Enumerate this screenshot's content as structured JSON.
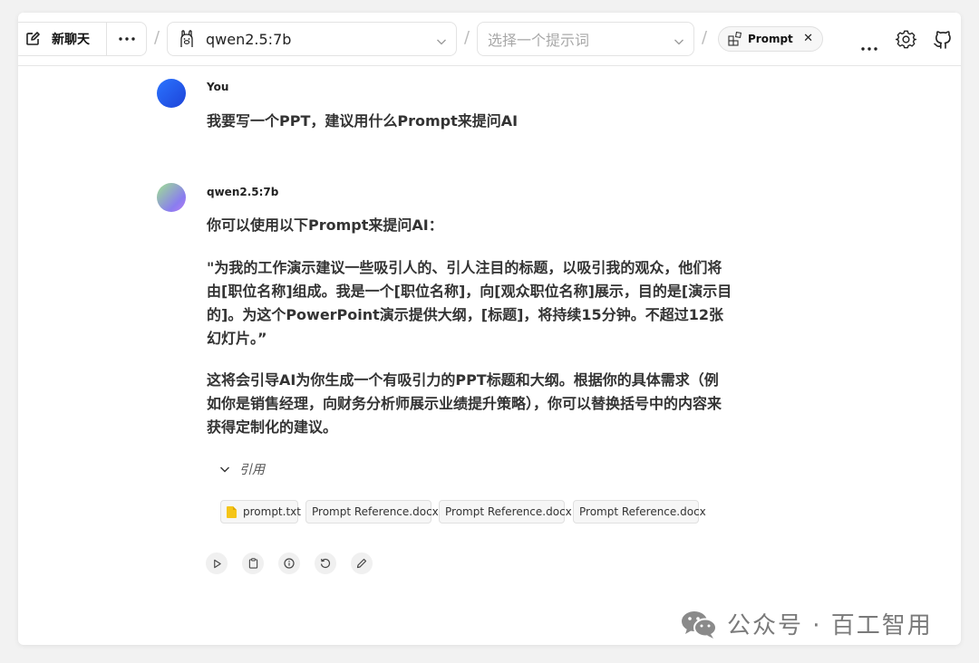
{
  "toolbar": {
    "new_chat_label": "新聊天",
    "model_value": "qwen2.5:7b",
    "prompt_placeholder": "选择一个提示词",
    "prompt_chip_label": "Prompt"
  },
  "messages": [
    {
      "sender": "You",
      "text": "我要写一个PPT，建议用什么Prompt来提问AI"
    },
    {
      "sender": "qwen2.5:7b",
      "paragraphs": [
        "你可以使用以下Prompt来提问AI：",
        "\"为我的工作演示建议一些吸引人的、引人注目的标题，以吸引我的观众，他们将由[职位名称]组成。我是一个[职位名称]，向[观众职位名称]展示，目的是[演示目的]。为这个PowerPoint演示提供大纲，[标题]，将持续15分钟。不超过12张幻灯片。”",
        "这将会引导AI为你生成一个有吸引力的PPT标题和大纲。根据你的具体需求（例如你是销售经理，向财务分析师展示业绩提升策略），你可以替换括号中的内容来获得定制化的建议。"
      ],
      "citations_label": "引用",
      "files": [
        "prompt.txt",
        "Prompt Reference.docx",
        "Prompt Reference.docx",
        "Prompt Reference.docx"
      ]
    }
  ],
  "watermark": "公众号 · 百工智用",
  "colors": {
    "user_avatar": "#2b74ff",
    "file_icon": "#f5c518"
  }
}
